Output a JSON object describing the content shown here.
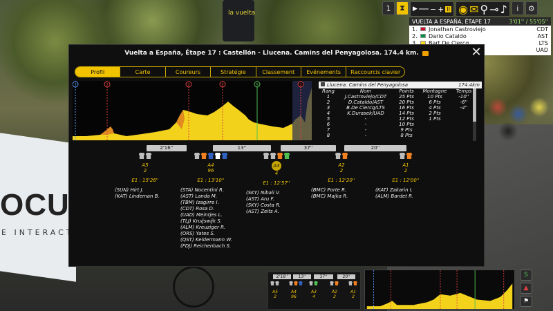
{
  "toolbar": {
    "speed_value": "1",
    "play": "▶",
    "minus": "−",
    "plus": "+",
    "pause": "II",
    "info": "i",
    "settings": "⚙"
  },
  "standings": {
    "title": "VUELTA A ESPAÑA, ÉTAPE 17",
    "time": "3'01'' / 55'05''",
    "rows": [
      {
        "pos": "1.",
        "name": "Jonathan Castroviejo",
        "team": "CDT",
        "flag": "#c8102e"
      },
      {
        "pos": "2.",
        "name": "Dario Cataldo",
        "team": "AST",
        "flag": "#009246"
      },
      {
        "pos": "3.",
        "name": "Bart De Clercq",
        "team": "LTS",
        "flag": "#fdda24"
      },
      {
        "pos": "4.",
        "name": "",
        "team": "UAD",
        "flag": "#ffffff"
      }
    ]
  },
  "panel": {
    "title": "Vuelta a España, Étape 17 : Castellón - Llucena. Camins del Penyagolosa. 174.4 km.",
    "close": "✕",
    "tabs": [
      "Profil",
      "Carte",
      "Coureurs",
      "Stratégie",
      "Classement",
      "Evénements",
      "Raccourcis clavier"
    ],
    "active_tab": "Profil"
  },
  "stage_table": {
    "location": "Llucena. Camins del Penyagolosa",
    "distance": "174.4km",
    "columns": [
      "Rang",
      "Nom",
      "Points",
      "Montagne",
      "Temps"
    ],
    "rows": [
      [
        "1",
        "J.Castroviejo/CDT",
        "25 Pts",
        "10 Pts",
        "-10''"
      ],
      [
        "2",
        "D.Cataldo/AST",
        "20 Pts",
        "6 Pts",
        "-6''"
      ],
      [
        "3",
        "B.De Clercq/LTS",
        "16 Pts",
        "4 Pts",
        "-4''"
      ],
      [
        "4",
        "K.Durasek/UAD",
        "14 Pts",
        "2 Pts",
        ""
      ],
      [
        "5",
        "-",
        "12 Pts",
        "1 Pts",
        ""
      ],
      [
        "6",
        "-",
        "10 Pts",
        "",
        ""
      ],
      [
        "7",
        "-",
        "9 Pts",
        "",
        ""
      ],
      [
        "8",
        "-",
        "8 Pts",
        "",
        ""
      ]
    ]
  },
  "profile_markers": [
    {
      "label": "↑",
      "color": "#5aa0ff"
    },
    {
      "label": "2",
      "color": "#e04040"
    },
    {
      "label": "2",
      "color": "#e04040"
    },
    {
      "label": "2",
      "color": "#e04040"
    },
    {
      "label": "S",
      "color": "#50c050"
    },
    {
      "label": "2",
      "color": "#e04040"
    }
  ],
  "gaps": [
    "2'16''",
    "13''",
    "37''",
    "20''"
  ],
  "groups": [
    {
      "label": "A5",
      "count": "2",
      "time": "E1 : 15'26''",
      "jerseys": [
        "#bdbdbd",
        "#bdbdbd"
      ],
      "riders": [
        "(SUN) Hirt J.",
        "(KAT) Lindeman B."
      ]
    },
    {
      "label": "A4",
      "count": "96",
      "time": "E1 : 13'10''",
      "jerseys": [
        "#bdbdbd",
        "#f08020",
        "#3060c0",
        "#ffffff",
        "#3060c0"
      ],
      "riders": [
        "(STA) Nocentini R.",
        "(AST) Landa M.",
        "(TBM) Izagirre I.",
        "(CDT) Rosa D.",
        "(UAD) Meintjes L.",
        "(TLJ) Kruijswijk S.",
        "(ALM) Kreuziger R.",
        "(ORS) Yates S.",
        "(QST) Keldermann W.",
        "(FDJ) Reichenbach S."
      ]
    },
    {
      "label": "A3",
      "count": "4",
      "time": "E1 : 12'57''",
      "jerseys": [
        "#bdbdbd",
        "#bdbdbd",
        "#f08020",
        "#50c050"
      ],
      "riders": [
        "(SKY) Nibali V.",
        "(AST) Aru F.",
        "(SKY) Costa R.",
        "(AST) Zeits A."
      ]
    },
    {
      "label": "A2",
      "count": "2",
      "time": "E1 : 12'20''",
      "jerseys": [
        "#bdbdbd",
        "#f08020"
      ],
      "riders": [
        "(BMC) Porte R.",
        "(BMC) Majka R."
      ]
    },
    {
      "label": "A1",
      "count": "2",
      "time": "E1 : 12'00''",
      "jerseys": [
        "#bdbdbd",
        "#f08020"
      ],
      "riders": [
        "(KAT) Zakarin I.",
        "(ALM) Bardet R."
      ]
    }
  ],
  "mini": {
    "gaps": [
      "2'16''",
      "13''",
      "37''",
      "20''"
    ],
    "groups": [
      {
        "label": "A5",
        "count": "2"
      },
      {
        "label": "A4",
        "count": "96"
      },
      {
        "label": "A3",
        "count": "4"
      },
      {
        "label": "A2",
        "count": "2"
      },
      {
        "label": "A1",
        "count": "2"
      }
    ]
  },
  "side_buttons": [
    "S",
    "▲",
    "⚑"
  ],
  "scene": {
    "banner": "OCUS",
    "banner_sub": "E INTERACTI",
    "pole_label": "la vuelta"
  }
}
